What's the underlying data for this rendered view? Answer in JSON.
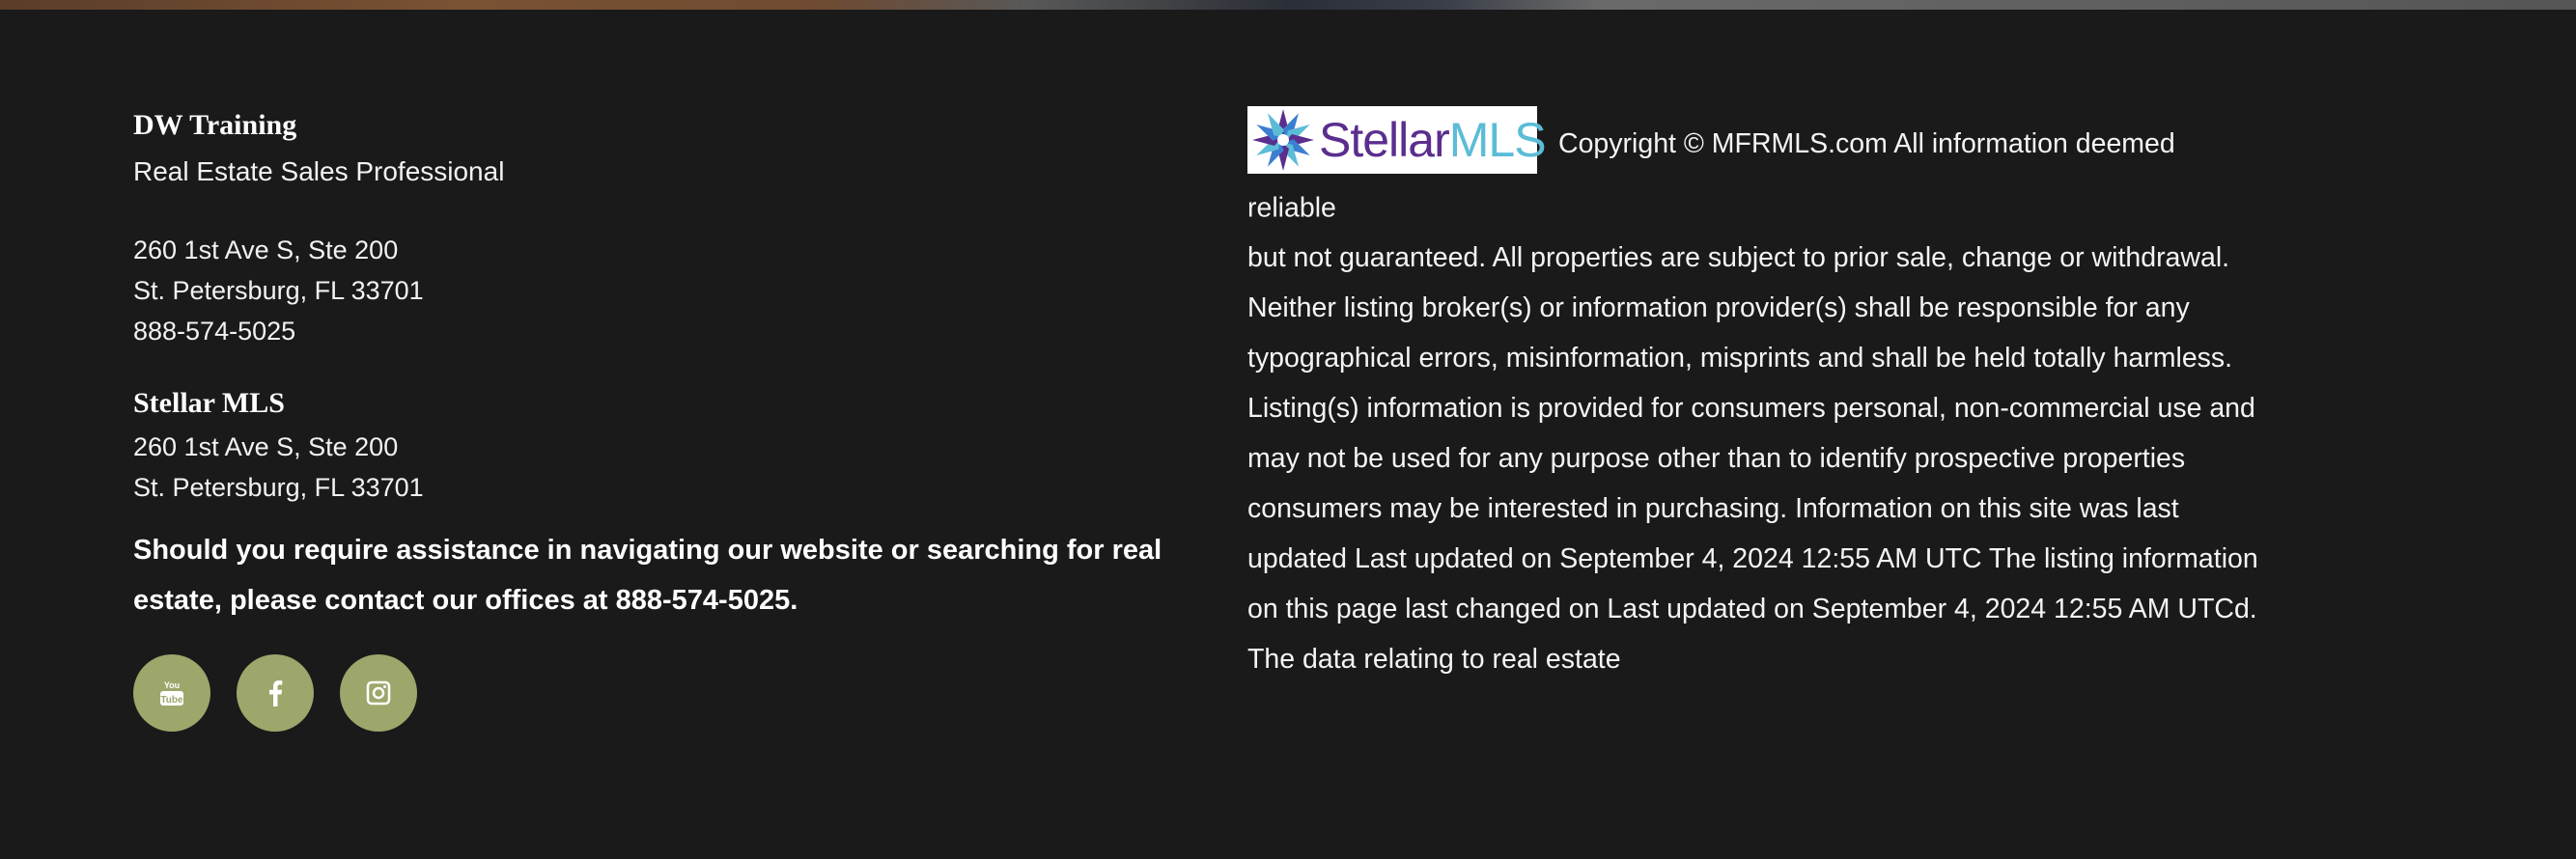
{
  "office": {
    "name": "DW Training",
    "title": "Real Estate Sales Professional",
    "address_line1": "260 1st Ave S, Ste 200",
    "address_line2": "St. Petersburg, FL 33701",
    "phone": "888-574-5025"
  },
  "brokerage": {
    "name": "Stellar MLS",
    "address_line1": "260 1st Ave S, Ste 200",
    "address_line2": "St. Petersburg, FL 33701"
  },
  "assistance": {
    "text_before": "Should you require assistance in navigating our website or searching for real estate, please contact our offices at ",
    "phone": "888-574-5025",
    "text_after": "."
  },
  "socials": [
    {
      "name": "YouTube",
      "icon": "youtube-icon"
    },
    {
      "name": "Facebook",
      "icon": "facebook-icon"
    },
    {
      "name": "Instagram",
      "icon": "instagram-icon"
    }
  ],
  "disclaimer": {
    "logo_text_1": "Stellar",
    "logo_text_2": "MLS",
    "first_line": "Copyright © MFRMLS.com All information deemed reliable",
    "body": "but not guaranteed. All properties are subject to prior sale, change or withdrawal. Neither listing broker(s) or information provider(s) shall be responsible for any typographical errors, misinformation, misprints and shall be held totally harmless. Listing(s) information is provided for consumers personal, non-commercial use and may not be used for any purpose other than to identify prospective properties consumers may be interested in purchasing. Information on this site was last updated Last updated on September 4, 2024 12:55 AM UTC The listing information on this page last changed on Last updated on September 4, 2024 12:55 AM UTCd. The data relating to real estate"
  },
  "colors": {
    "background": "#1a1a1a",
    "social_button": "#9da66b",
    "text": "#ffffff",
    "logo_purple": "#5b2d8e",
    "logo_cyan": "#5bbcd6"
  }
}
